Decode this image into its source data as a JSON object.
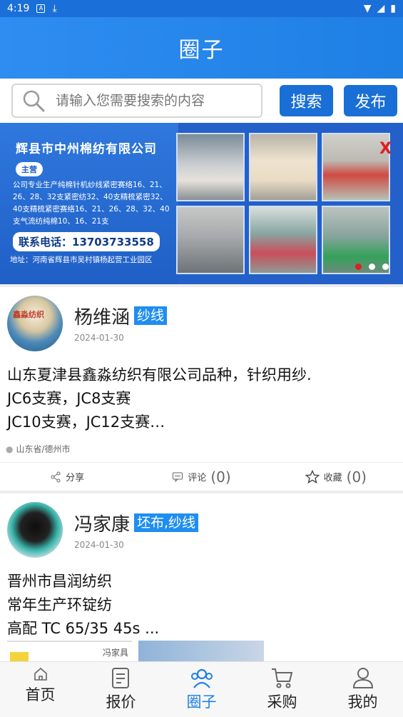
{
  "statusbar": {
    "time": "4:19"
  },
  "header": {
    "title": "圈子"
  },
  "search": {
    "placeholder": "请输入您需要搜索的内容",
    "search_label": "搜索",
    "publish_label": "发布"
  },
  "banner": {
    "company": "辉县市中州棉纺有限公司",
    "tag": "主营",
    "desc": "公司专业生产纯棉针机纱线紧密赛络16、21、26、28、32支紧密纺32、40支精梳紧密32、40支精梳紧密赛络16、21、26、28、32、40支气流纺纯棉10、16、21支",
    "phone": "联系电话：13703733558",
    "address": "地址：河南省辉县市吴村镇杨起营工业园区",
    "close": "X"
  },
  "posts": [
    {
      "avatar_text": "鑫淼纺织",
      "name": "杨维涵",
      "badge": "纱线",
      "date": "2024-01-30",
      "lines": [
        "山东夏津县鑫淼纺织有限公司品种，针织用纱.",
        "JC6支赛，JC8支赛",
        "JC10支赛，JC12支赛…"
      ],
      "location": "山东省/德州市",
      "share": "分享",
      "comment": "评论",
      "comment_count": "(0)",
      "fav": "收藏",
      "fav_count": "(0)"
    },
    {
      "name": "冯家康",
      "badge": "坯布,纱线",
      "date": "2024-01-30",
      "lines": [
        "晋州市昌润纺织",
        "常年生产环锭纺",
        "高配 TC 65/35 45s ..."
      ],
      "thumb_text": "冯家具"
    }
  ],
  "tabs": [
    {
      "label": "首页",
      "icon": "home-icon"
    },
    {
      "label": "报价",
      "icon": "document-icon"
    },
    {
      "label": "圈子",
      "icon": "group-icon"
    },
    {
      "label": "采购",
      "icon": "cart-icon"
    },
    {
      "label": "我的",
      "icon": "user-icon"
    }
  ],
  "colors": {
    "primary": "#1e7fe4",
    "badge": "#1f8ef0",
    "dot_active": "#e02020"
  }
}
